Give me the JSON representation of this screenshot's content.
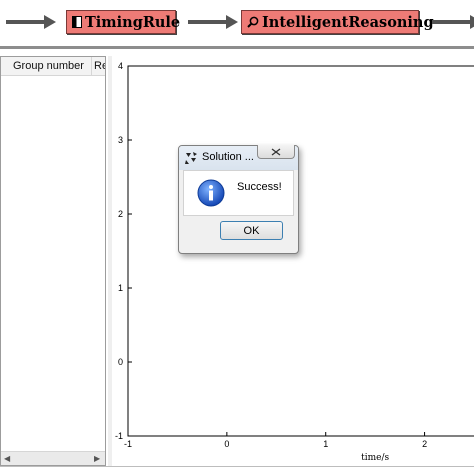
{
  "workflow": {
    "steps": [
      {
        "label": "TimingRule",
        "icon": "table-icon"
      },
      {
        "label": "IntelligentReasoning",
        "icon": "magnifier-icon"
      }
    ],
    "colors": {
      "step_fill": "#ee7b76",
      "arrow": "#555555"
    }
  },
  "table": {
    "columns": [
      "Group number",
      "Re"
    ]
  },
  "chart_data": {
    "type": "line",
    "title": "",
    "xlabel": "time/s",
    "ylabel": "",
    "xlim": [
      -1,
      2.5
    ],
    "ylim": [
      -1,
      4
    ],
    "xticks": [
      -1,
      0,
      1,
      2
    ],
    "yticks": [
      -1,
      0,
      1,
      2,
      3,
      4
    ],
    "series": [],
    "grid": false
  },
  "dialog": {
    "title": "Solution ...",
    "message": "Success!",
    "ok_label": "OK",
    "icon": "info-icon"
  }
}
